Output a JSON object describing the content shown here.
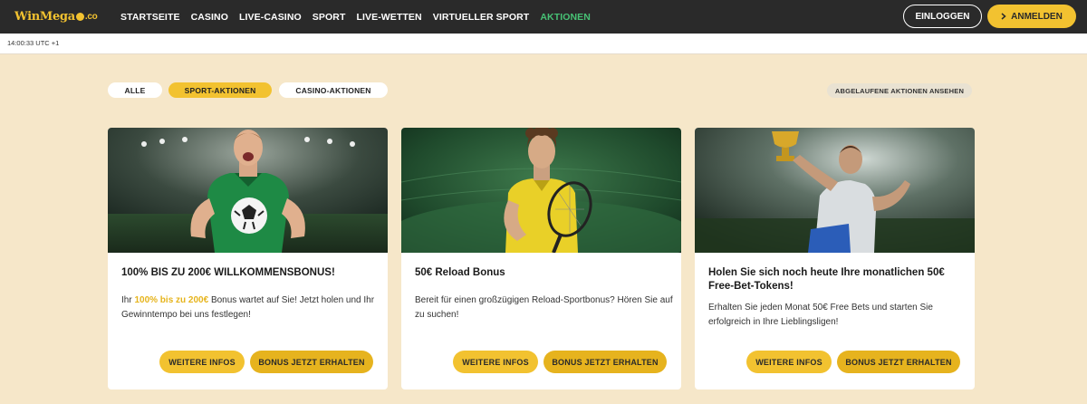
{
  "brand": {
    "logo_win": "Win",
    "logo_mega": "Mega",
    "logo_co": ".co"
  },
  "nav": {
    "items": [
      "STARTSEITE",
      "CASINO",
      "LIVE-CASINO",
      "SPORT",
      "LIVE-WETTEN",
      "VIRTUELLER SPORT",
      "AKTIONEN"
    ],
    "active_index": 6,
    "active_color": "#47c275"
  },
  "auth": {
    "login_label": "EINLOGGEN",
    "register_label": "ANMELDEN",
    "register_icon": "chevron-right-icon"
  },
  "time": "14:00:33 UTC +1",
  "filters": {
    "all": "ALLE",
    "sport": "SPORT-AKTIONEN",
    "casino": "CASINO-AKTIONEN",
    "active": "SPORT-AKTIONEN",
    "expired": "ABGELAUFENE AKTIONEN ANSEHEN"
  },
  "colors": {
    "accent": "#f2c230",
    "page_bg": "#f6e7c9",
    "nav_bg": "#2a2a2a"
  },
  "cards": [
    {
      "title": "100% BIS ZU 200€ WILLKOMMENSBONUS!",
      "text_before": "Ihr ",
      "text_highlight": "100% bis zu 200€",
      "text_after": " Bonus wartet auf Sie! Jetzt holen und Ihr Gewinntempo bei uns festlegen!",
      "info_label": "WEITERE INFOS",
      "bonus_label": "BONUS JETZT ERHALTEN",
      "image": "soccer-player-image"
    },
    {
      "title": "50€ Reload Bonus",
      "text": "Bereit für einen großzügigen Reload-Sportbonus? Hören Sie auf zu suchen!",
      "info_label": "WEITERE INFOS",
      "bonus_label": "BONUS JETZT ERHALTEN",
      "image": "tennis-player-image"
    },
    {
      "title": "Holen Sie sich noch heute Ihre monatlichen 50€ Free-Bet-Tokens!",
      "text": "Erhalten Sie jeden Monat 50€ Free Bets und starten Sie erfolgreich in Ihre Lieblingsligen!",
      "info_label": "WEITERE INFOS",
      "bonus_label": "BONUS JETZT ERHALTEN",
      "image": "trophy-athlete-image"
    }
  ]
}
